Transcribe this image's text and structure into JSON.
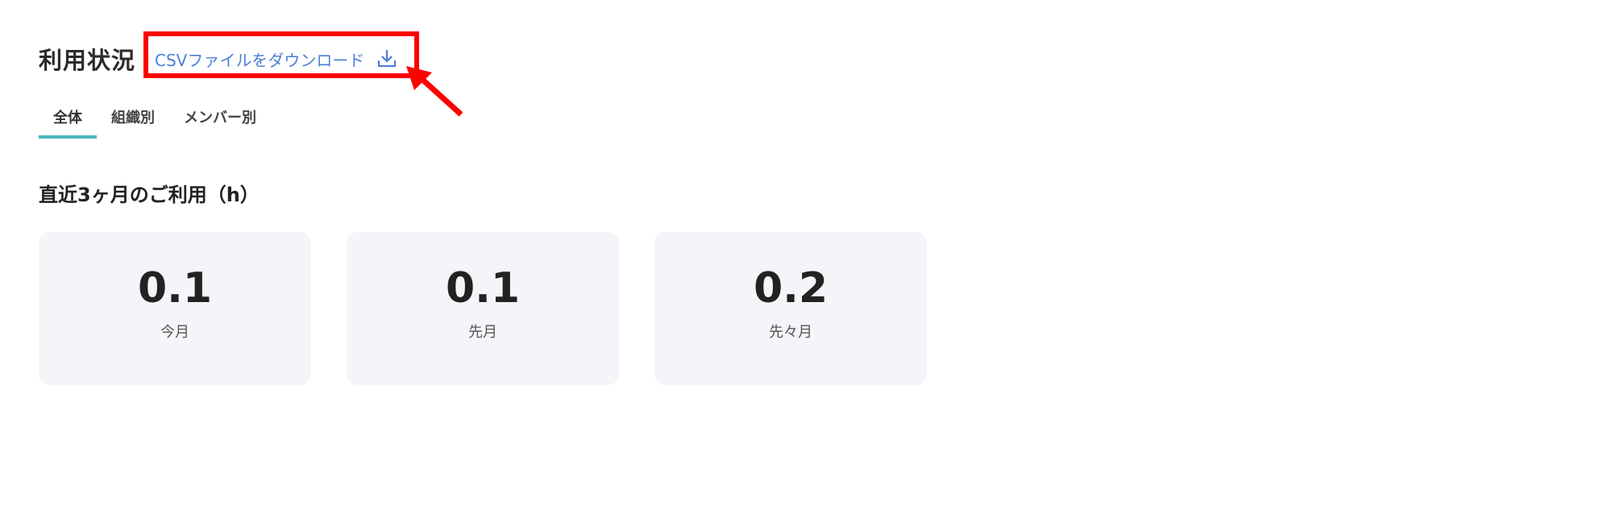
{
  "header": {
    "title": "利用状況",
    "csv_download_label": "CSVファイルをダウンロード",
    "download_icon": "download-icon"
  },
  "tabs": [
    {
      "label": "全体",
      "active": true
    },
    {
      "label": "組織別",
      "active": false
    },
    {
      "label": "メンバー別",
      "active": false
    }
  ],
  "usage": {
    "section_title": "直近3ヶ月のご利用（h）",
    "cards": [
      {
        "value": "0.1",
        "label": "今月"
      },
      {
        "value": "0.1",
        "label": "先月"
      },
      {
        "value": "0.2",
        "label": "先々月"
      }
    ]
  },
  "colors": {
    "accent": "#4bb8bd",
    "link": "#4d7fd6",
    "annotation": "#ff0000",
    "card_bg": "#f3f5f9"
  }
}
